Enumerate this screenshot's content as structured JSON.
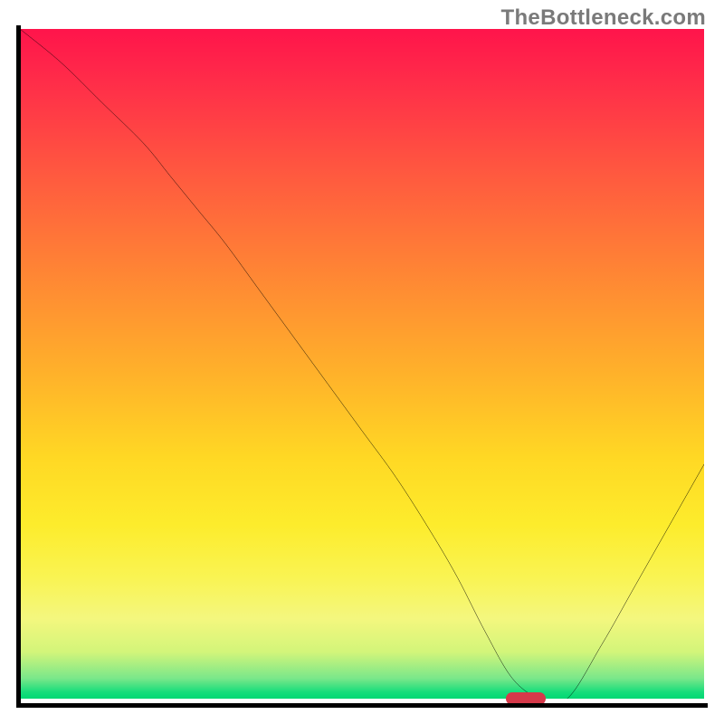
{
  "watermark": "TheBottleneck.com",
  "colors": {
    "gradient_top": "#ff144b",
    "gradient_bottom": "#00d873",
    "curve": "#000000",
    "marker": "#d6394a",
    "axis": "#000000"
  },
  "chart_data": {
    "type": "line",
    "title": "",
    "xlabel": "",
    "ylabel": "",
    "xlim": [
      0,
      100
    ],
    "ylim": [
      0,
      100
    ],
    "x": [
      0,
      6,
      12,
      18,
      22,
      26,
      30,
      35,
      40,
      45,
      50,
      55,
      60,
      64,
      68,
      72,
      76,
      80,
      85,
      90,
      95,
      100
    ],
    "values": [
      100,
      95,
      89,
      83,
      78,
      73,
      68,
      61,
      54,
      47,
      40,
      33,
      25,
      18,
      10,
      3,
      0,
      0,
      8,
      17,
      26,
      35
    ],
    "marker": {
      "x": 74,
      "y": 0
    },
    "annotations": [
      "TheBottleneck.com"
    ]
  }
}
